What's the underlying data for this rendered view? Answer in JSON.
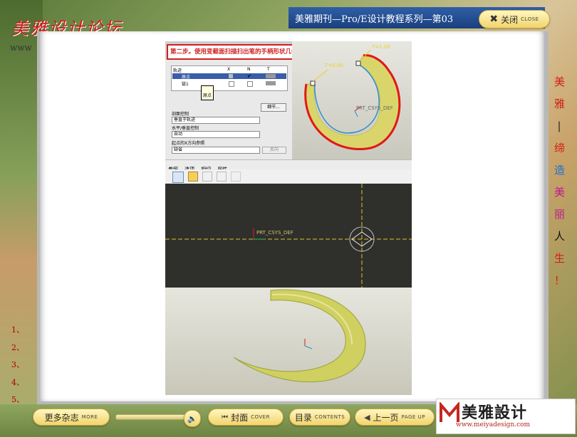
{
  "forum": {
    "title": "美雅设计论坛",
    "www": "www"
  },
  "header": {
    "title": "美雅期刊—Pro/E设计教程系列—第03"
  },
  "close_button": {
    "label": "关闭",
    "sub": "CLOSE"
  },
  "left_list": [
    "1、",
    "2、",
    "3、",
    "4、",
    "5、"
  ],
  "slogan": [
    {
      "char": "美",
      "color": "#d0201c"
    },
    {
      "char": "雅",
      "color": "#d0201c"
    },
    {
      "char": "|",
      "color": "#222222"
    },
    {
      "char": "缔",
      "color": "#d0201c"
    },
    {
      "char": "造",
      "color": "#1e6fd0"
    },
    {
      "char": "美",
      "color": "#c01890"
    },
    {
      "char": "丽",
      "color": "#c01890"
    },
    {
      "char": "人",
      "color": "#111111"
    },
    {
      "char": "生",
      "color": "#d0201c"
    },
    {
      "char": "！",
      "color": "#d0201c"
    }
  ],
  "screenshot": {
    "step_caption": "第二步。使用变截面扫描扫出笔的手柄形状几何",
    "table": {
      "headers": [
        "轨迹",
        "X",
        "N",
        "T"
      ],
      "rows": [
        [
          "原点"
        ],
        [
          "链1"
        ]
      ],
      "tooltip": "原点"
    },
    "detail_button": "细节...",
    "section_ctrl_label": "剖面控制",
    "section_ctrl_value": "垂直于轨迹",
    "hv_ctrl_label": "水平/垂直控制",
    "hv_ctrl_value": "自动",
    "start_x_label": "起点的X方向参照",
    "start_x_value": "缺省",
    "reverse_button": "反向",
    "tabs": [
      "参照",
      "选项",
      "相切",
      "属性"
    ],
    "top_dims": [
      "T=0.00",
      "T=1.00"
    ],
    "csys_label": "PRT_CSYS_DEF",
    "dark_csys_label": "PRT_CSYS_DEF"
  },
  "toolbar": {
    "more": {
      "label": "更多杂志",
      "sub": "MORE"
    },
    "cover": {
      "label": "封面",
      "sub": "COVER"
    },
    "toc": {
      "label": "目录",
      "sub": "CONTENTS"
    },
    "prev": {
      "label": "上一页",
      "sub": "PAGE UP"
    }
  },
  "logo": {
    "text": "美雅設计",
    "url": "www.meiyadesign.com"
  },
  "colors": {
    "header": "#2f5fa7",
    "accent": "#f1d46b",
    "caption_red": "#d02020"
  }
}
